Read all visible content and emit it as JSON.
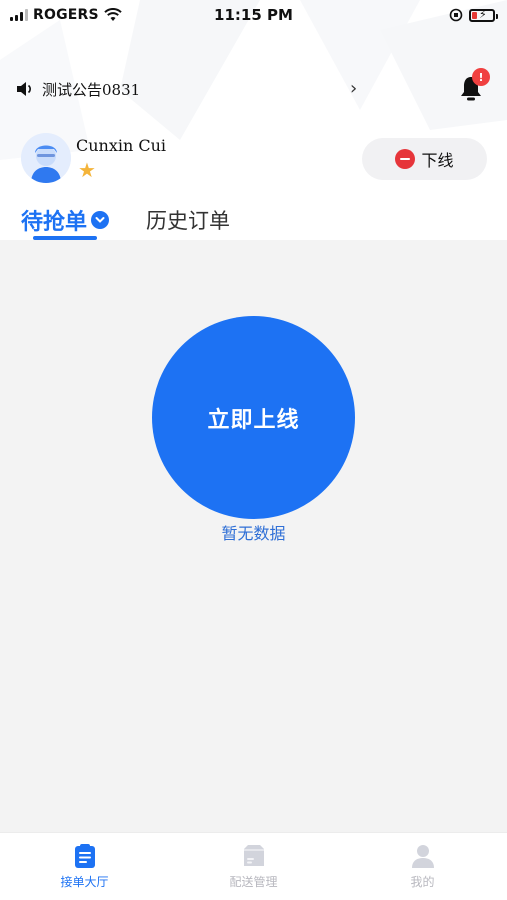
{
  "status_bar": {
    "carrier": "ROGERS",
    "time": "11:15 PM"
  },
  "notice": {
    "text": "测试公告0831",
    "badge": "!"
  },
  "user": {
    "name": "Cunxin Cui",
    "star_icon": "star-icon"
  },
  "offline_button": {
    "label": "下线"
  },
  "tabs": [
    {
      "label": "待抢单",
      "active": true
    },
    {
      "label": "历史订单",
      "active": false
    }
  ],
  "main": {
    "go_online_label": "立即上线",
    "empty_text": "暂无数据"
  },
  "bottom_nav": [
    {
      "label": "接单大厅",
      "icon": "clipboard-icon",
      "active": true
    },
    {
      "label": "配送管理",
      "icon": "package-icon",
      "active": false
    },
    {
      "label": "我的",
      "icon": "person-icon",
      "active": false
    }
  ],
  "colors": {
    "accent": "#1d72f3",
    "danger": "#e6353a",
    "star": "#f4b43a",
    "content_bg": "#f3f3f3"
  }
}
